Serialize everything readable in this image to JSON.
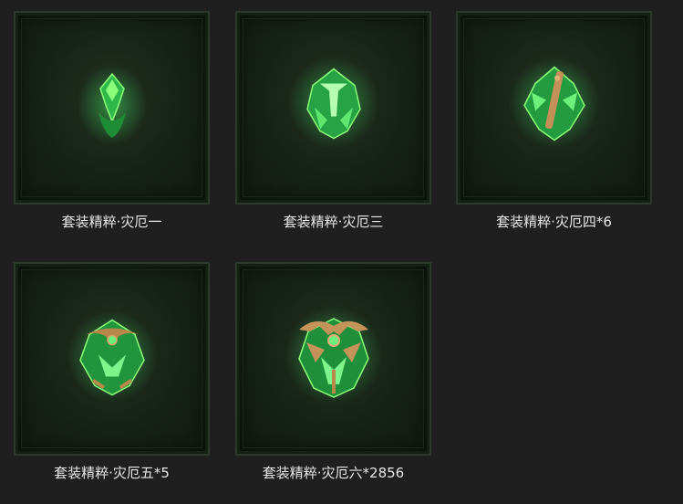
{
  "items": [
    {
      "label": "套装精粹·灾厄一"
    },
    {
      "label": "套装精粹·灾厄三"
    },
    {
      "label": "套装精粹·灾厄四*6"
    },
    {
      "label": "套装精粹·灾厄五*5"
    },
    {
      "label": "套装精粹·灾厄六*2856"
    }
  ],
  "colors": {
    "background": "#1f1f1f",
    "frame_border": "#2c3a2c",
    "essence_green": "#3fd35a",
    "essence_bright": "#8cff7a",
    "bronze": "#b8874a",
    "label_text": "#e6e6e6"
  }
}
